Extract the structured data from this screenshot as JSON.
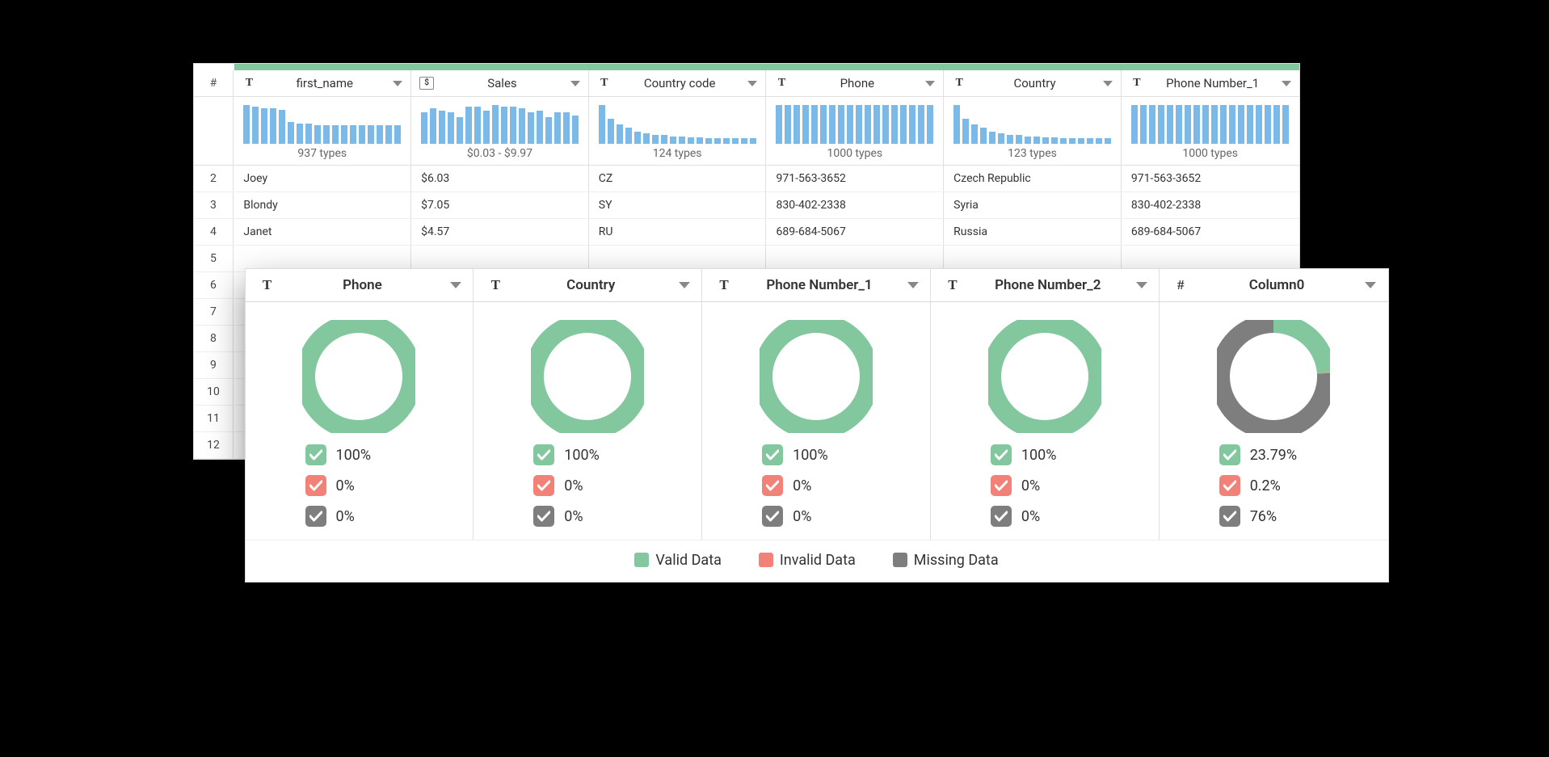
{
  "grid": {
    "corner": "#",
    "columns": [
      {
        "type": "T",
        "name": "first_name",
        "types_label": "937 types",
        "hist": [
          46,
          44,
          42,
          42,
          40,
          26,
          24,
          24,
          22,
          22,
          22,
          22,
          22,
          22,
          22,
          22,
          22,
          22
        ]
      },
      {
        "type": "$",
        "name": "Sales",
        "types_label": "$0.03 - $9.97",
        "hist": [
          36,
          40,
          38,
          36,
          30,
          42,
          42,
          38,
          44,
          42,
          42,
          40,
          36,
          38,
          30,
          36,
          36,
          32
        ]
      },
      {
        "type": "T",
        "name": "Country code",
        "types_label": "124 types",
        "hist": [
          44,
          28,
          22,
          18,
          14,
          12,
          10,
          10,
          8,
          8,
          7,
          7,
          6,
          6,
          6,
          6,
          6,
          6
        ]
      },
      {
        "type": "T",
        "name": "Phone",
        "types_label": "1000 types",
        "hist": [
          44,
          44,
          44,
          44,
          44,
          44,
          44,
          44,
          44,
          44,
          44,
          44,
          44,
          44,
          44,
          44,
          44,
          44
        ]
      },
      {
        "type": "T",
        "name": "Country",
        "types_label": "123 types",
        "hist": [
          44,
          28,
          22,
          18,
          14,
          12,
          10,
          10,
          8,
          8,
          7,
          7,
          6,
          6,
          6,
          6,
          6,
          6
        ]
      },
      {
        "type": "T",
        "name": "Phone Number_1",
        "types_label": "1000 types",
        "hist": [
          44,
          44,
          44,
          44,
          44,
          44,
          44,
          44,
          44,
          44,
          44,
          44,
          44,
          44,
          44,
          44,
          44,
          44
        ]
      }
    ],
    "rows": [
      {
        "n": "2",
        "cells": [
          "Joey",
          "$6.03",
          "CZ",
          "971-563-3652",
          "Czech Republic",
          "971-563-3652"
        ]
      },
      {
        "n": "3",
        "cells": [
          "Blondy",
          "$7.05",
          "SY",
          "830-402-2338",
          "Syria",
          "830-402-2338"
        ]
      },
      {
        "n": "4",
        "cells": [
          "Janet",
          "$4.57",
          "RU",
          "689-684-5067",
          "Russia",
          "689-684-5067"
        ]
      },
      {
        "n": "5",
        "cells": [
          "",
          "",
          "",
          "",
          "",
          ""
        ]
      },
      {
        "n": "6",
        "cells": [
          "",
          "",
          "",
          "",
          "",
          ""
        ]
      },
      {
        "n": "7",
        "cells": [
          "",
          "",
          "",
          "",
          "",
          ""
        ]
      },
      {
        "n": "8",
        "cells": [
          "",
          "",
          "",
          "",
          "",
          ""
        ]
      },
      {
        "n": "9",
        "cells": [
          "",
          "",
          "",
          "",
          "",
          ""
        ]
      },
      {
        "n": "10",
        "cells": [
          "",
          "",
          "",
          "",
          "",
          ""
        ]
      },
      {
        "n": "11",
        "cells": [
          "",
          "",
          "",
          "",
          "",
          ""
        ]
      },
      {
        "n": "12",
        "cells": [
          "",
          "",
          "",
          "",
          "",
          ""
        ]
      }
    ]
  },
  "quality": {
    "columns": [
      {
        "type": "T",
        "name": "Phone",
        "valid": "100%",
        "invalid": "0%",
        "missing": "0%",
        "donut": {
          "valid": 100,
          "invalid": 0,
          "missing": 0
        }
      },
      {
        "type": "T",
        "name": "Country",
        "valid": "100%",
        "invalid": "0%",
        "missing": "0%",
        "donut": {
          "valid": 100,
          "invalid": 0,
          "missing": 0
        }
      },
      {
        "type": "T",
        "name": "Phone Number_1",
        "valid": "100%",
        "invalid": "0%",
        "missing": "0%",
        "donut": {
          "valid": 100,
          "invalid": 0,
          "missing": 0
        }
      },
      {
        "type": "T",
        "name": "Phone Number_2",
        "valid": "100%",
        "invalid": "0%",
        "missing": "0%",
        "donut": {
          "valid": 100,
          "invalid": 0,
          "missing": 0
        }
      },
      {
        "type": "#",
        "name": "Column0",
        "valid": "23.79%",
        "invalid": "0.2%",
        "missing": "76%",
        "donut": {
          "valid": 23.79,
          "invalid": 0.2,
          "missing": 76.01
        }
      }
    ],
    "legend": {
      "valid": "Valid Data",
      "invalid": "Invalid Data",
      "missing": "Missing Data"
    }
  },
  "colors": {
    "valid": "#82c79e",
    "invalid": "#f28278",
    "missing": "#7e7e7e"
  },
  "chart_data": {
    "histograms": [
      {
        "column": "first_name",
        "type": "bar",
        "values": [
          46,
          44,
          42,
          42,
          40,
          26,
          24,
          24,
          22,
          22,
          22,
          22,
          22,
          22,
          22,
          22,
          22,
          22
        ],
        "summary": "937 types"
      },
      {
        "column": "Sales",
        "type": "bar",
        "values": [
          36,
          40,
          38,
          36,
          30,
          42,
          42,
          38,
          44,
          42,
          42,
          40,
          36,
          38,
          30,
          36,
          36,
          32
        ],
        "summary": "$0.03 - $9.97"
      },
      {
        "column": "Country code",
        "type": "bar",
        "values": [
          44,
          28,
          22,
          18,
          14,
          12,
          10,
          10,
          8,
          8,
          7,
          7,
          6,
          6,
          6,
          6,
          6,
          6
        ],
        "summary": "124 types"
      },
      {
        "column": "Phone",
        "type": "bar",
        "values": [
          44,
          44,
          44,
          44,
          44,
          44,
          44,
          44,
          44,
          44,
          44,
          44,
          44,
          44,
          44,
          44,
          44,
          44
        ],
        "summary": "1000 types"
      },
      {
        "column": "Country",
        "type": "bar",
        "values": [
          44,
          28,
          22,
          18,
          14,
          12,
          10,
          10,
          8,
          8,
          7,
          7,
          6,
          6,
          6,
          6,
          6,
          6
        ],
        "summary": "123 types"
      },
      {
        "column": "Phone Number_1",
        "type": "bar",
        "values": [
          44,
          44,
          44,
          44,
          44,
          44,
          44,
          44,
          44,
          44,
          44,
          44,
          44,
          44,
          44,
          44,
          44,
          44
        ],
        "summary": "1000 types"
      }
    ],
    "donuts": [
      {
        "column": "Phone",
        "type": "pie",
        "slices": {
          "Valid Data": 100,
          "Invalid Data": 0,
          "Missing Data": 0
        }
      },
      {
        "column": "Country",
        "type": "pie",
        "slices": {
          "Valid Data": 100,
          "Invalid Data": 0,
          "Missing Data": 0
        }
      },
      {
        "column": "Phone Number_1",
        "type": "pie",
        "slices": {
          "Valid Data": 100,
          "Invalid Data": 0,
          "Missing Data": 0
        }
      },
      {
        "column": "Phone Number_2",
        "type": "pie",
        "slices": {
          "Valid Data": 100,
          "Invalid Data": 0,
          "Missing Data": 0
        }
      },
      {
        "column": "Column0",
        "type": "pie",
        "slices": {
          "Valid Data": 23.79,
          "Invalid Data": 0.2,
          "Missing Data": 76.01
        }
      }
    ]
  }
}
